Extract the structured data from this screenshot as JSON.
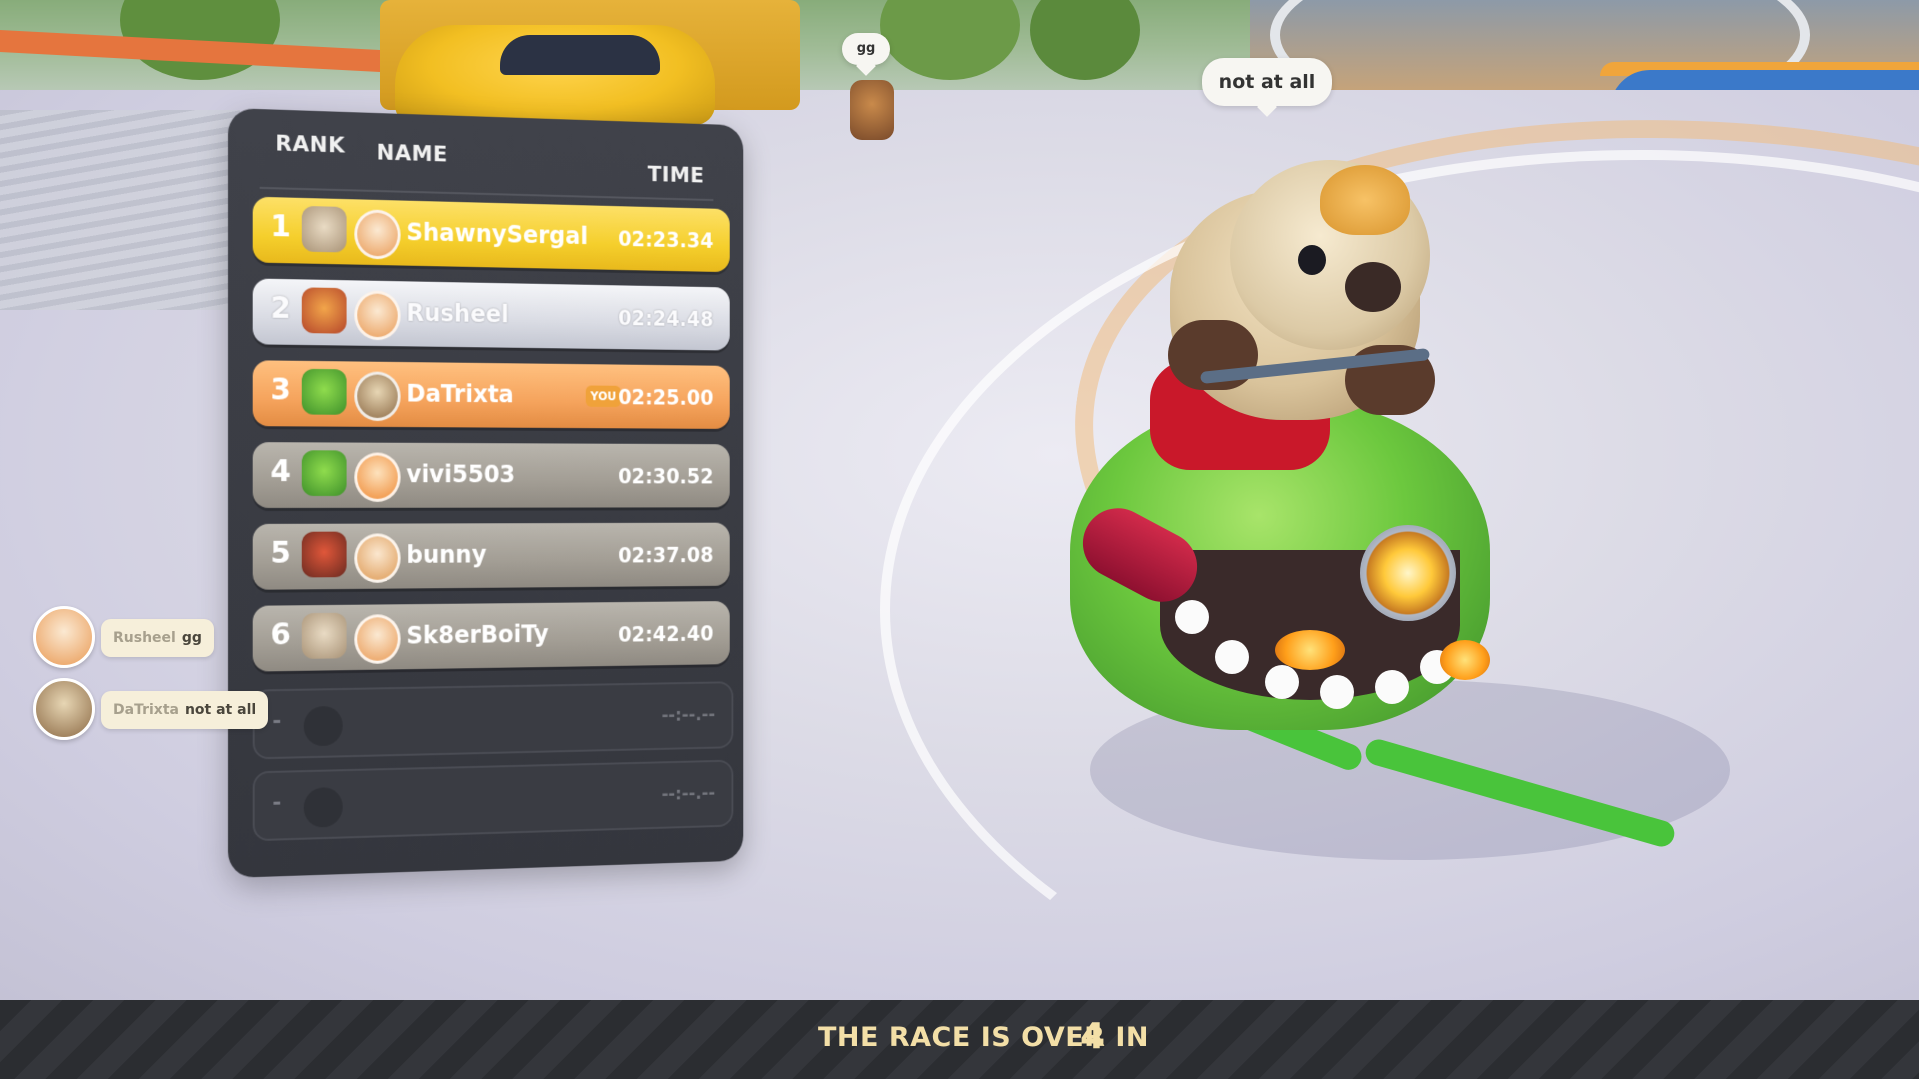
{
  "world": {
    "bubble_far": "gg",
    "bubble_near": "not at all"
  },
  "leaderboard": {
    "headers": {
      "rank": "RANK",
      "name": "NAME",
      "time": "TIME"
    },
    "rows": [
      {
        "rank": "1",
        "name": "ShawnySergal",
        "time": "02:23.34",
        "style": "gold",
        "kart_icon": "kart-icon",
        "pet_icon": "corgi-avatar-icon"
      },
      {
        "rank": "2",
        "name": "Rusheel",
        "time": "02:24.48",
        "style": "silver",
        "kart_icon": "kart-icon",
        "pet_icon": "corgi-santa-avatar-icon"
      },
      {
        "rank": "3",
        "name": "DaTrixta",
        "time": "02:25.00",
        "style": "bronze",
        "you_badge": "YOU",
        "kart_icon": "kart-icon",
        "pet_icon": "quokka-avatar-icon"
      },
      {
        "rank": "4",
        "name": "vivi5503",
        "time": "02:30.52",
        "style": "grey",
        "kart_icon": "kart-icon",
        "pet_icon": "tiger-avatar-icon"
      },
      {
        "rank": "5",
        "name": "bunny",
        "time": "02:37.08",
        "style": "grey",
        "kart_icon": "kart-icon",
        "pet_icon": "shiba-avatar-icon"
      },
      {
        "rank": "6",
        "name": "Sk8erBoiTy",
        "time": "02:42.40",
        "style": "grey",
        "kart_icon": "kart-icon",
        "pet_icon": "corgi-avatar-icon"
      }
    ],
    "empty_rows": [
      {
        "rank": "-",
        "time": "--:--.--"
      },
      {
        "rank": "-",
        "time": "--:--.--"
      }
    ]
  },
  "chat": [
    {
      "name": "Rusheel",
      "message": "gg"
    },
    {
      "name": "DaTrixta",
      "message": "not at all"
    }
  ],
  "countdown": {
    "label": "THE RACE IS OVER IN",
    "seconds": "4"
  },
  "colors": {
    "gold": "#f5cf2c",
    "silver": "#d9dbe3",
    "bronze": "#f5a35c",
    "grey": "#a29d94",
    "panel": "#3a3c43",
    "countdown_text": "#f3dfa7"
  }
}
